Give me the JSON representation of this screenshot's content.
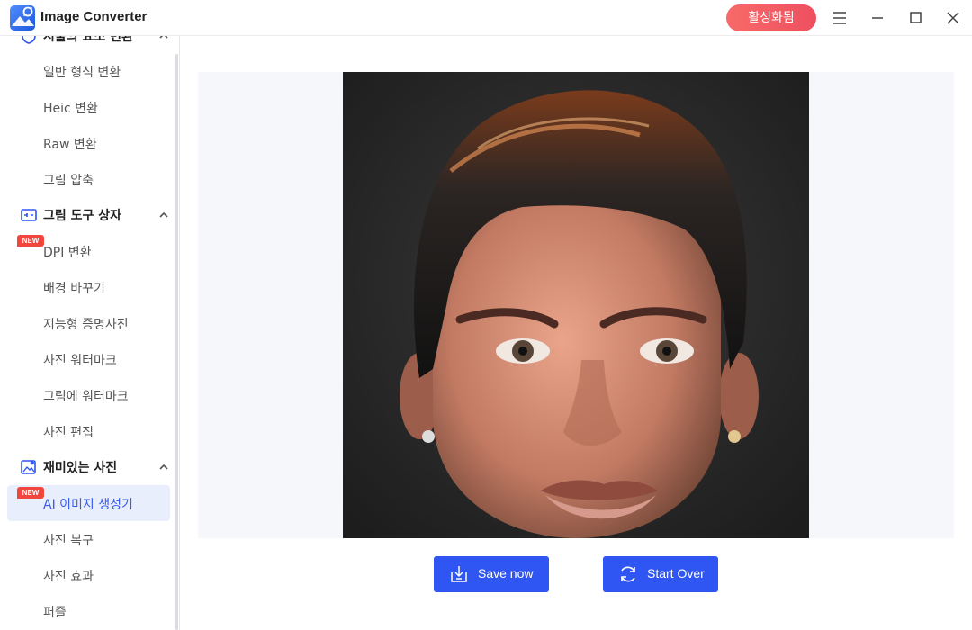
{
  "app": {
    "title": "Image Converter",
    "activate_label": "활성화됨"
  },
  "sidebar": {
    "partial_top_label": "시출의 요소 변환",
    "items_group1": [
      {
        "label": "일반 형식 변환"
      },
      {
        "label": "Heic 변환"
      },
      {
        "label": "Raw 변환"
      },
      {
        "label": "그림 압축"
      }
    ],
    "section_tools": {
      "label": "그림 도구 상자"
    },
    "items_tools": [
      {
        "label": "DPI 변환",
        "badge": "NEW"
      },
      {
        "label": "배경 바꾸기"
      },
      {
        "label": "지능형 증명사진"
      },
      {
        "label": "사진 워터마크"
      },
      {
        "label": "그림에 워터마크"
      },
      {
        "label": "사진 편집"
      }
    ],
    "section_fun": {
      "label": "재미있는 사진"
    },
    "items_fun": [
      {
        "label": "AI 이미지 생성기",
        "badge": "NEW",
        "active": true
      },
      {
        "label": "사진 복구"
      },
      {
        "label": "사진 효과"
      },
      {
        "label": "퍼즐"
      }
    ]
  },
  "main": {
    "save_label": "Save now",
    "start_over_label": "Start Over"
  },
  "colors": {
    "accent": "#2f55f2",
    "badge": "#f0463e",
    "activate": "#f2575f",
    "active_bg": "#e9eefc"
  }
}
